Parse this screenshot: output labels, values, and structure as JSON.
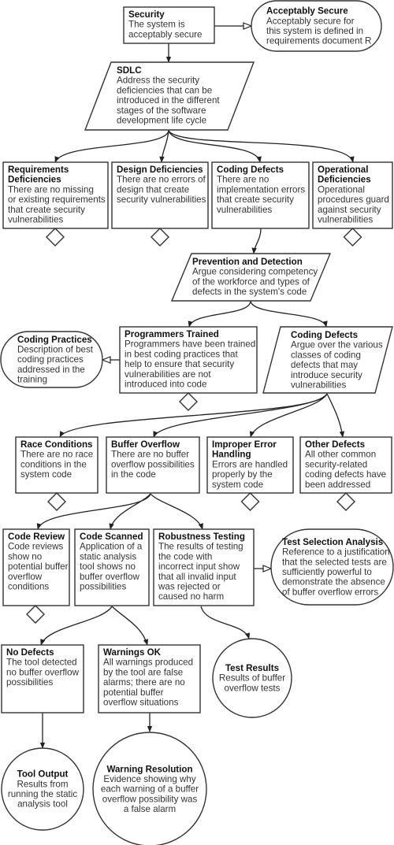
{
  "colors": {
    "stroke": "#333333",
    "text": "#333333",
    "background": "#ffffff"
  },
  "nodes": {
    "security": {
      "type": "goal",
      "title": "Security",
      "lines": [
        "The system is",
        "acceptably secure"
      ]
    },
    "acceptably_secure": {
      "type": "context",
      "title": "Acceptably Secure",
      "lines": [
        "Acceptably secure for",
        "this system is defined in",
        "requirements document R"
      ]
    },
    "sdlc": {
      "type": "strategy",
      "title": "SDLC",
      "lines": [
        "Address the security",
        "deficiencies that can be",
        "introduced in the different",
        "stages of the software",
        "development life cycle"
      ]
    },
    "requirements_deficiencies": {
      "type": "goal",
      "title": "Requirements",
      "title2": "Deficiencies",
      "lines": [
        "There are no missing",
        "or existing requirements",
        "that create security",
        "vulnerabilities"
      ]
    },
    "design_deficiencies": {
      "type": "goal",
      "title": "Design Deficiencies",
      "lines": [
        "There are no errors of",
        "design that create",
        "security vulnerabilities"
      ]
    },
    "coding_defects_goal": {
      "type": "goal",
      "title": "Coding Defects",
      "lines": [
        "There are no",
        "implementation errors",
        "that create security",
        "vulnerabilities"
      ]
    },
    "operational_deficiencies": {
      "type": "goal",
      "title": "Operational",
      "title2": "Deficiencies",
      "lines": [
        "Operational",
        "procedures guard",
        "against security",
        "vulnerabilities"
      ]
    },
    "prevention_detection": {
      "type": "strategy",
      "title": "Prevention and Detection",
      "lines": [
        "Argue considering competency",
        "of the workforce and types of",
        "defects in the system's code"
      ]
    },
    "coding_practices": {
      "type": "context",
      "title": "Coding Practices",
      "lines": [
        "Description of best",
        "coding practices",
        "addressed in the",
        "training"
      ]
    },
    "programmers_trained": {
      "type": "goal",
      "title": "Programmers Trained",
      "lines": [
        "Programmers have been trained",
        "in best coding practices that",
        "help to ensure that security",
        "vulnerabilities are not",
        "introduced into code"
      ]
    },
    "coding_defects_strategy": {
      "type": "strategy",
      "title": "Coding Defects",
      "lines": [
        "Argue over the various",
        "classes of coding",
        "defects that may",
        "introduce security",
        "vulnerabilities"
      ]
    },
    "race_conditions": {
      "type": "goal",
      "title": "Race Conditions",
      "lines": [
        "There are no race",
        "conditions in the",
        "system code"
      ]
    },
    "buffer_overflow": {
      "type": "goal",
      "title": "Buffer Overflow",
      "lines": [
        "There are no buffer",
        "overflow possibilities",
        "in the code"
      ]
    },
    "improper_error_handling": {
      "type": "goal",
      "title": "Improper Error",
      "title2": "Handling",
      "lines": [
        "Errors are handled",
        "properly by the",
        "system code"
      ]
    },
    "other_defects": {
      "type": "goal",
      "title": "Other Defects",
      "lines": [
        "All other common",
        "security-related",
        "coding defects have",
        "been addressed"
      ]
    },
    "code_review": {
      "type": "goal",
      "title": "Code Review",
      "lines": [
        "Code reviews",
        "show no",
        "potential buffer",
        "overflow",
        "conditions"
      ]
    },
    "code_scanned": {
      "type": "goal",
      "title": "Code Scanned",
      "lines": [
        "Application of a",
        "static analysis",
        "tool shows no",
        "buffer overflow",
        "possibilities"
      ]
    },
    "robustness_testing": {
      "type": "goal",
      "title": "Robustness Testing",
      "lines": [
        "The results of testing",
        "the code with",
        "incorrect input show",
        "that all invalid input",
        "was rejected or",
        "caused no harm"
      ]
    },
    "test_selection_analysis": {
      "type": "context",
      "title": "Test Selection Analysis",
      "lines": [
        "Reference to a justification",
        "that the selected tests are",
        "sufficiently powerful to",
        "demonstrate the absence",
        "of buffer overflow errors"
      ]
    },
    "no_defects": {
      "type": "goal",
      "title": "No Defects",
      "lines": [
        "The tool detected",
        "no buffer overflow",
        "possibilities"
      ]
    },
    "warnings_ok": {
      "type": "goal",
      "title": "Warnings OK",
      "lines": [
        "All warnings produced",
        "by the tool are false",
        "alarms; there are no",
        "potential buffer",
        "overflow situations"
      ]
    },
    "test_results": {
      "type": "solution",
      "title": "Test Results",
      "lines": [
        "Results of buffer",
        "overflow tests"
      ]
    },
    "tool_output": {
      "type": "solution",
      "title": "Tool Output",
      "lines": [
        "Results from",
        "running the static",
        "analysis tool"
      ]
    },
    "warning_resolution": {
      "type": "solution",
      "title": "Warning Resolution",
      "lines": [
        "Evidence showing why",
        "each warning of a buffer",
        "overflow possibility was",
        "a false alarm"
      ]
    }
  },
  "undeveloped": [
    "requirements_deficiencies",
    "design_deficiencies",
    "operational_deficiencies",
    "programmers_trained",
    "race_conditions",
    "improper_error_handling",
    "other_defects",
    "code_review"
  ],
  "edges": [
    {
      "from": "security",
      "to": "sdlc",
      "kind": "supported_by"
    },
    {
      "from": "security",
      "to": "acceptably_secure",
      "kind": "in_context_of"
    },
    {
      "from": "sdlc",
      "to": "requirements_deficiencies",
      "kind": "supported_by"
    },
    {
      "from": "sdlc",
      "to": "design_deficiencies",
      "kind": "supported_by"
    },
    {
      "from": "sdlc",
      "to": "coding_defects_goal",
      "kind": "supported_by"
    },
    {
      "from": "sdlc",
      "to": "operational_deficiencies",
      "kind": "supported_by"
    },
    {
      "from": "coding_defects_goal",
      "to": "prevention_detection",
      "kind": "supported_by"
    },
    {
      "from": "prevention_detection",
      "to": "programmers_trained",
      "kind": "supported_by"
    },
    {
      "from": "prevention_detection",
      "to": "coding_defects_strategy",
      "kind": "supported_by"
    },
    {
      "from": "programmers_trained",
      "to": "coding_practices",
      "kind": "in_context_of"
    },
    {
      "from": "coding_defects_strategy",
      "to": "race_conditions",
      "kind": "supported_by"
    },
    {
      "from": "coding_defects_strategy",
      "to": "buffer_overflow",
      "kind": "supported_by"
    },
    {
      "from": "coding_defects_strategy",
      "to": "improper_error_handling",
      "kind": "supported_by"
    },
    {
      "from": "coding_defects_strategy",
      "to": "other_defects",
      "kind": "supported_by"
    },
    {
      "from": "buffer_overflow",
      "to": "code_review",
      "kind": "supported_by"
    },
    {
      "from": "buffer_overflow",
      "to": "code_scanned",
      "kind": "supported_by"
    },
    {
      "from": "buffer_overflow",
      "to": "robustness_testing",
      "kind": "supported_by"
    },
    {
      "from": "robustness_testing",
      "to": "test_selection_analysis",
      "kind": "in_context_of"
    },
    {
      "from": "robustness_testing",
      "to": "test_results",
      "kind": "supported_by"
    },
    {
      "from": "code_scanned",
      "to": "no_defects",
      "kind": "supported_by"
    },
    {
      "from": "code_scanned",
      "to": "warnings_ok",
      "kind": "supported_by"
    },
    {
      "from": "no_defects",
      "to": "tool_output",
      "kind": "supported_by"
    },
    {
      "from": "warnings_ok",
      "to": "warning_resolution",
      "kind": "supported_by"
    }
  ]
}
